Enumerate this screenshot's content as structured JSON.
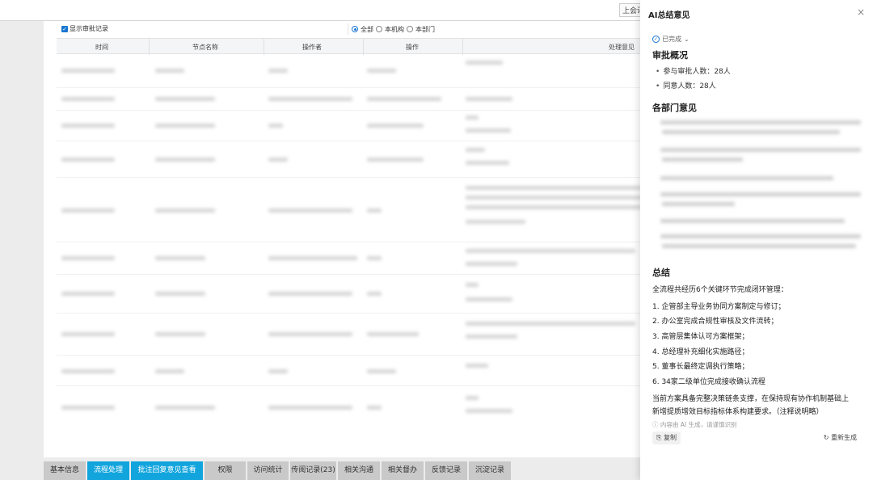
{
  "topbar": {
    "prev_button": "上会讯"
  },
  "filter": {
    "show_records_label": "显示审批记录",
    "scope_all": "全部",
    "scope_org": "本机构",
    "scope_dept": "本部门"
  },
  "table": {
    "columns": [
      "时间",
      "节点名称",
      "操作者",
      "操作",
      "处理意见"
    ]
  },
  "tabs": [
    {
      "label": "基本信息",
      "active": false
    },
    {
      "label": "流程处理",
      "active": true
    },
    {
      "label": "批注回复意见查看",
      "active": true
    },
    {
      "label": "权限",
      "active": false
    },
    {
      "label": "访问统计",
      "active": false
    },
    {
      "label": "传阅记录(23)",
      "active": false
    },
    {
      "label": "相关沟通",
      "active": false
    },
    {
      "label": "相关督办",
      "active": false
    },
    {
      "label": "反馈记录",
      "active": false
    },
    {
      "label": "沉淀记录",
      "active": false
    }
  ],
  "ai_panel": {
    "title": "AI总结意见",
    "close_glyph": "×",
    "status": "已完成",
    "overview_heading": "审批概况",
    "overview_items": [
      "参与审批人数：28人",
      "同意人数：28人"
    ],
    "dept_heading": "各部门意见",
    "summary_heading": "总结",
    "summary_intro": "全流程共经历6个关键环节完成闭环管理：",
    "summary_steps": [
      "1. 企管部主导业务协同方案制定与修订；",
      "2. 办公室完成合规性审核及文件流转；",
      "3. 高管层集体认可方案框架；",
      "4. 总经理补充细化实施路径；",
      "5. 董事长最终定调执行策略；",
      "6. 34家二级单位完成接收确认流程"
    ],
    "conclusion_line1": "当前方案具备完整决策链条支撑，在保持现有协作机制基础上",
    "conclusion_line2": "新增提质增效目标指标体系构建要求。（注释说明略）",
    "disclaimer": "内容由 AI 生成，请谨慎识别",
    "copy_label": "复制",
    "regenerate_label": "重新生成"
  }
}
